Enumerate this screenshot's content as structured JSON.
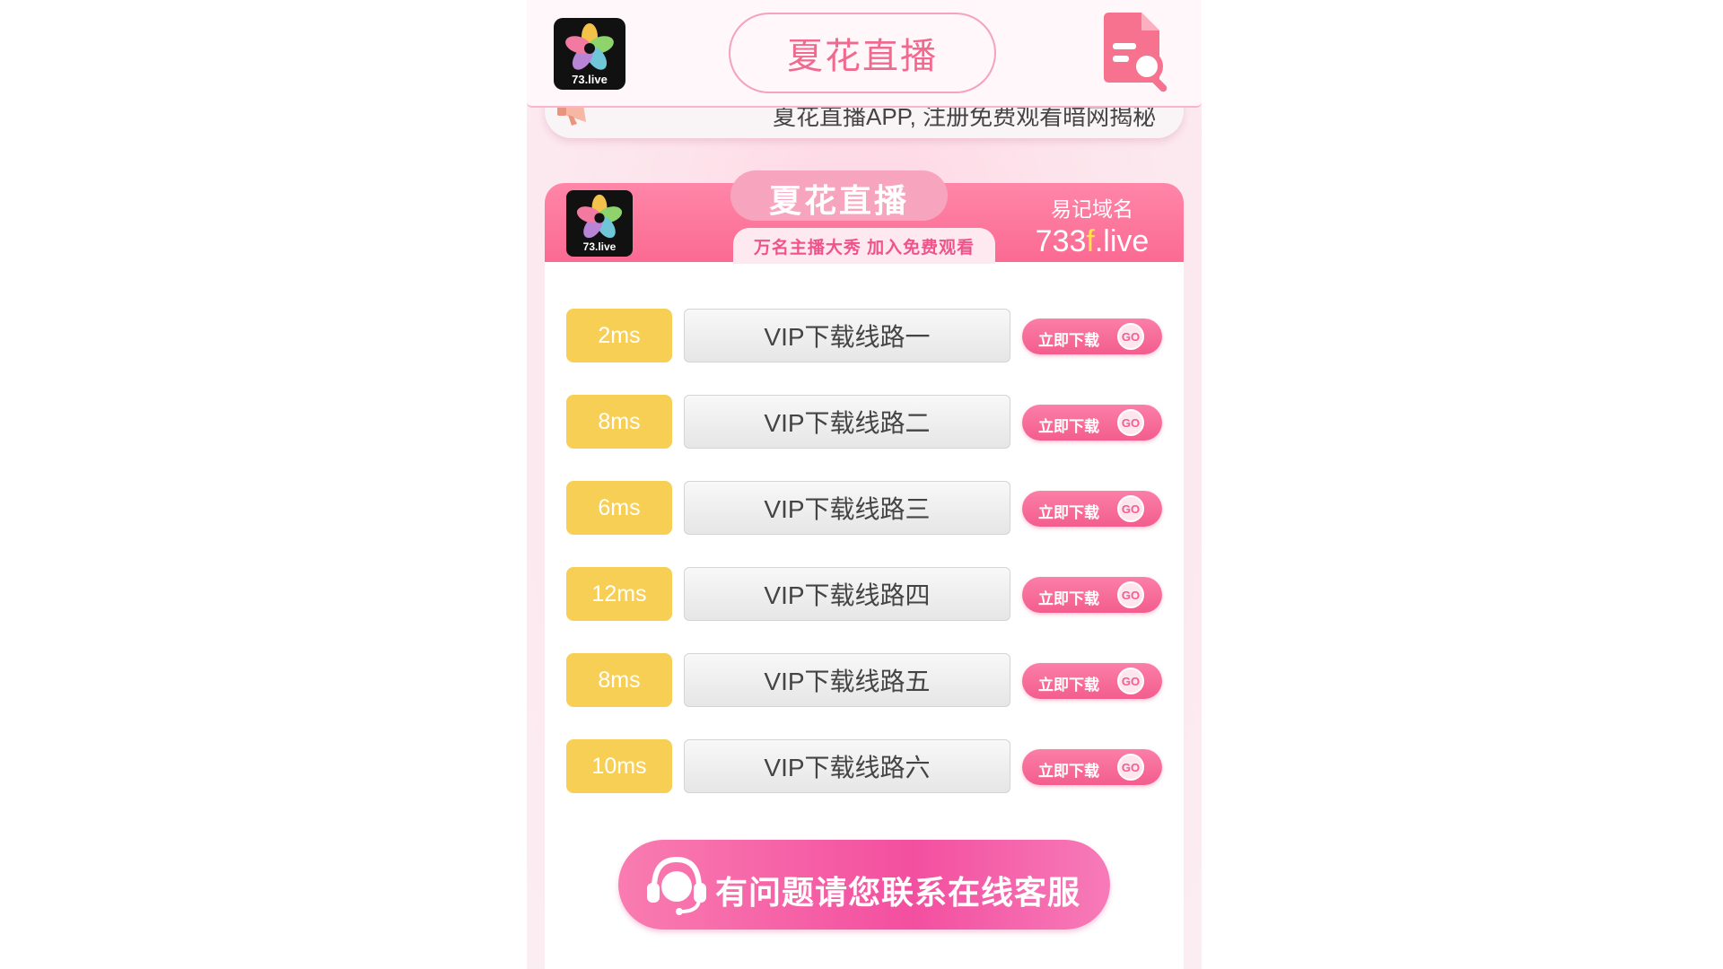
{
  "header": {
    "logo_text": "73.live",
    "title": "夏花直播"
  },
  "marquee": {
    "text": "夏花直播APP, 注册免费观看暗网揭秘"
  },
  "card": {
    "logo_text": "73.live",
    "brand": "夏花直播",
    "slogan": "万名主播大秀  加入免费观看",
    "domain_label": "易记域名",
    "domain_prefix": "733",
    "domain_highlight": "f",
    "domain_suffix": ".live"
  },
  "routes": [
    {
      "latency": "2ms",
      "label": "VIP下载线路一",
      "action": "立即下载",
      "go": "GO"
    },
    {
      "latency": "8ms",
      "label": "VIP下载线路二",
      "action": "立即下载",
      "go": "GO"
    },
    {
      "latency": "6ms",
      "label": "VIP下载线路三",
      "action": "立即下载",
      "go": "GO"
    },
    {
      "latency": "12ms",
      "label": "VIP下载线路四",
      "action": "立即下载",
      "go": "GO"
    },
    {
      "latency": "8ms",
      "label": "VIP下载线路五",
      "action": "立即下载",
      "go": "GO"
    },
    {
      "latency": "10ms",
      "label": "VIP下载线路六",
      "action": "立即下载",
      "go": "GO"
    }
  ],
  "service": {
    "label": "有问题请您联系在线客服"
  },
  "colors": {
    "brand_pink": "#fb6a93",
    "latency_yellow": "#f7cf55",
    "domain_highlight": "#ffe24a"
  }
}
